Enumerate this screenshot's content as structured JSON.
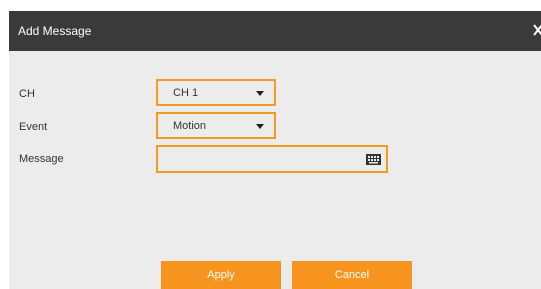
{
  "dialog": {
    "title": "Add Message",
    "close_icon": "close-icon",
    "accent_color": "#f39c1f"
  },
  "form": {
    "ch": {
      "label": "CH",
      "value": "CH 1"
    },
    "event": {
      "label": "Event",
      "value": "Motion"
    },
    "message": {
      "label": "Message",
      "value": "",
      "icon": "keyboard-icon"
    }
  },
  "buttons": {
    "apply": "Apply",
    "cancel": "Cancel"
  }
}
